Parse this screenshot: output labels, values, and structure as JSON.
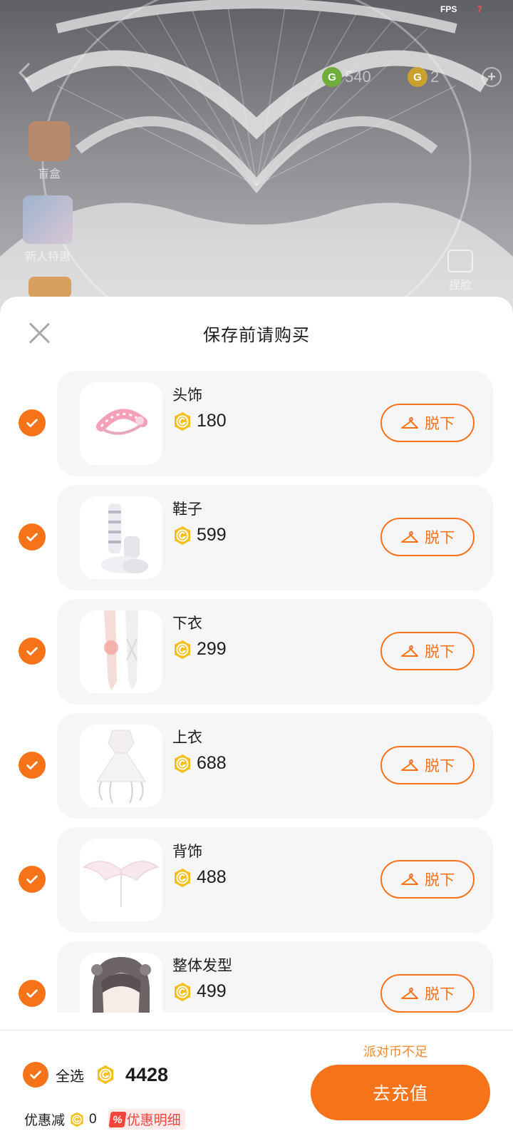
{
  "hud": {
    "fps_label": "FPS",
    "fps_value": "7",
    "green_currency": {
      "icon": "g-coin-green-icon",
      "value": "540"
    },
    "gold_currency": {
      "icon": "g-coin-gold-icon",
      "value": "2"
    },
    "add_icon": "plus-icon"
  },
  "side_menu": {
    "blind_box": "盲盒",
    "new_pack": "新人特惠",
    "pinch_face": "捏脸"
  },
  "sheet": {
    "title": "保存前请购买",
    "close_icon": "close-icon"
  },
  "items": [
    {
      "name": "头饰",
      "price": "180",
      "action": "脱下",
      "image": "headband"
    },
    {
      "name": "鞋子",
      "price": "599",
      "action": "脱下",
      "image": "shoes"
    },
    {
      "name": "下衣",
      "price": "299",
      "action": "脱下",
      "image": "stockings"
    },
    {
      "name": "上衣",
      "price": "688",
      "action": "脱下",
      "image": "dress"
    },
    {
      "name": "背饰",
      "price": "488",
      "action": "脱下",
      "image": "wings"
    },
    {
      "name": "整体发型",
      "price": "499",
      "action": "脱下",
      "image": "hairstyle"
    }
  ],
  "footer": {
    "insufficient_text": "派对币不足",
    "select_all_label": "全选",
    "total": "4428",
    "discount_label": "优惠减",
    "discount_value": "0",
    "discount_badge": "%",
    "discount_detail": "优惠明细",
    "recharge_button": "去充值"
  },
  "colors": {
    "accent": "#f7731a",
    "coin": "#f4bf1c",
    "discount_red": "#f2453b",
    "card_bg": "#f6f5f7"
  }
}
